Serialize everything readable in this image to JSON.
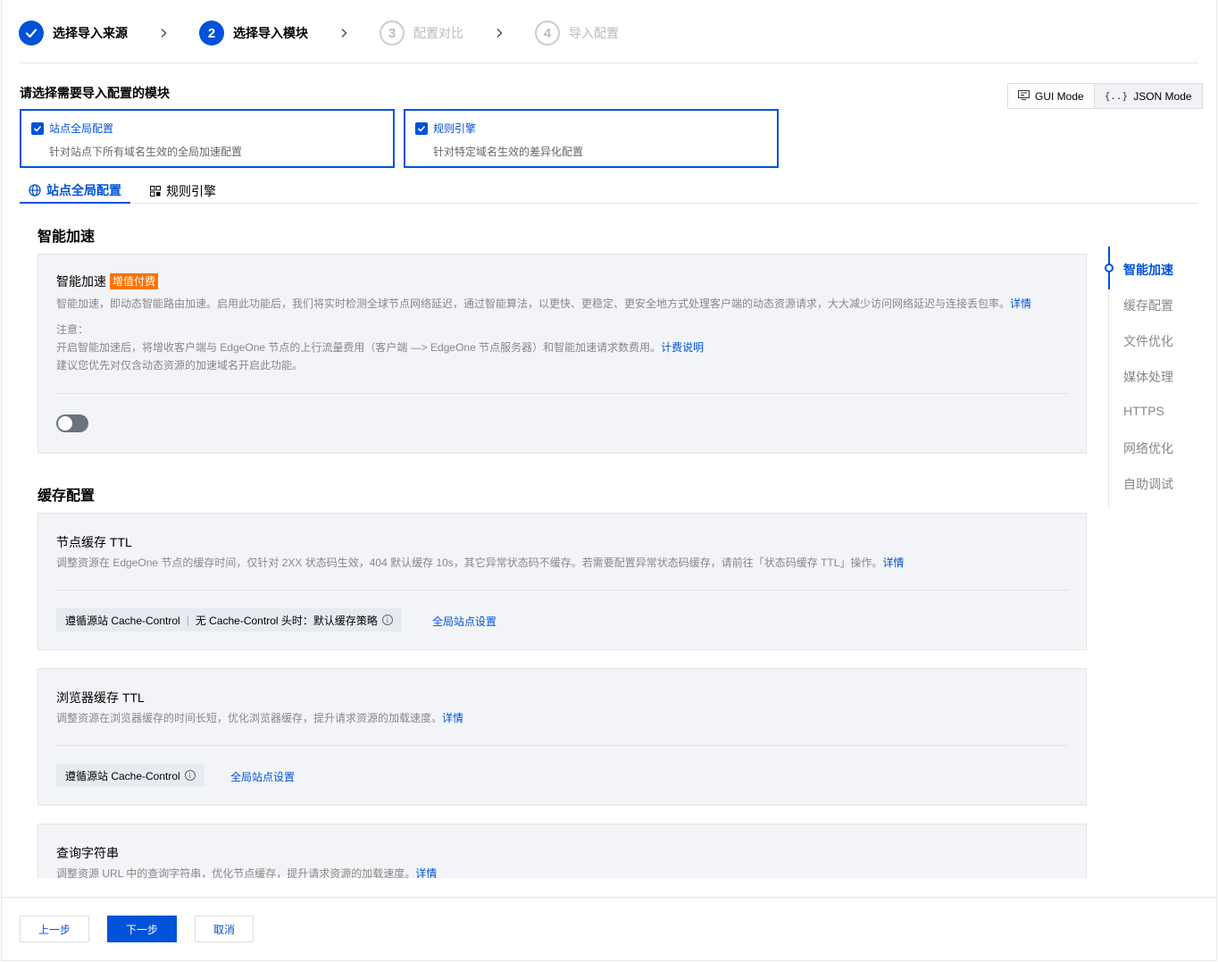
{
  "steps": [
    {
      "label": "选择导入来源",
      "num": "",
      "state": "done"
    },
    {
      "label": "选择导入模块",
      "num": "2",
      "state": "active"
    },
    {
      "label": "配置对比",
      "num": "3",
      "state": "todo"
    },
    {
      "label": "导入配置",
      "num": "4",
      "state": "todo"
    }
  ],
  "select_title": "请选择需要导入配置的模块",
  "mode": {
    "gui": "GUI Mode",
    "json": "JSON Mode"
  },
  "modules": [
    {
      "title": "站点全局配置",
      "desc": "针对站点下所有域名生效的全局加速配置",
      "checked": true
    },
    {
      "title": "规则引擎",
      "desc": "针对特定域名生效的差异化配置",
      "checked": true
    }
  ],
  "tabs": [
    "站点全局配置",
    "规则引擎"
  ],
  "smart": {
    "group": "智能加速",
    "title": "智能加速",
    "badge": "增值付费",
    "desc": "智能加速，即动态智能路由加速。启用此功能后，我们将实时检测全球节点网络延迟，通过智能算法，以更快、更稳定、更安全地方式处理客户端的动态资源请求，大大减少访问网络延迟与连接丢包率。",
    "desc_link": "详情",
    "note_label": "注意：",
    "note1": "开启智能加速后，将增收客户端与 EdgeOne 节点的上行流量费用（客户端 —> EdgeOne 节点服务器）和智能加速请求数费用。",
    "note1_link": "计费说明",
    "note2": "建议您优先对仅含动态资源的加速域名开启此功能。",
    "enabled": false
  },
  "cache": {
    "group": "缓存配置",
    "node": {
      "title": "节点缓存 TTL",
      "desc": "调整资源在 EdgeOne 节点的缓存时间，仅针对 2XX 状态码生效，404 默认缓存 10s，其它异常状态码不缓存。若需要配置异常状态码缓存，请前往「状态码缓存 TTL」操作。",
      "desc_link": "详情",
      "tag_a": "遵循源站 Cache-Control",
      "tag_sep": "|",
      "tag_b": "无 Cache-Control 头时：默认缓存策略",
      "link": "全局站点设置"
    },
    "browser": {
      "title": "浏览器缓存 TTL",
      "desc": "调整资源在浏览器缓存的时间长短，优化浏览器缓存，提升请求资源的加载速度。",
      "desc_link": "详情",
      "tag_a": "遵循源站 Cache-Control",
      "link": "全局站点设置"
    },
    "query": {
      "title": "查询字符串",
      "desc": "调整资源 URL 中的查询字符串，优化节点缓存，提升请求资源的加载速度。",
      "desc_link": "详情"
    }
  },
  "anchor": [
    "智能加速",
    "缓存配置",
    "文件优化",
    "媒体处理",
    "HTTPS",
    "网络优化",
    "自助调试"
  ],
  "footer": {
    "prev": "上一步",
    "next": "下一步",
    "cancel": "取消"
  },
  "colors": {
    "primary": "#0052d9",
    "badge": "#ff7200"
  }
}
